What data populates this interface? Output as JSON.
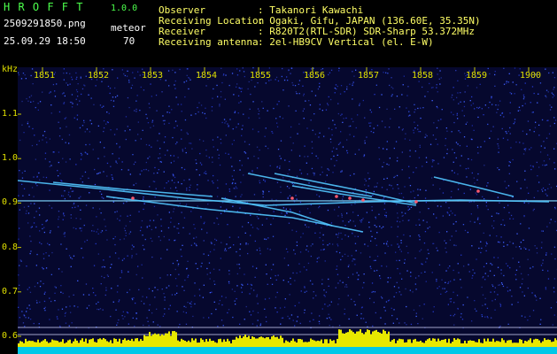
{
  "app": {
    "name": "H R O F F T",
    "version": "1.0.0",
    "file": "2509291850.png",
    "datetime": "25.09.29 18:50",
    "category_label": "meteor",
    "count": "70"
  },
  "info": {
    "rows": [
      {
        "key": "Observer",
        "value": ": Takanori Kawachi"
      },
      {
        "key": "Receiving Location",
        "value": ": Ogaki, Gifu, JAPAN (136.60E, 35.35N)"
      },
      {
        "key": "Receiver",
        "value": ": R820T2(RTL-SDR) SDR-Sharp 53.372MHz"
      },
      {
        "key": "Receiving antenna",
        "value": ": 2el-HB9CV Vertical (el. E-W)"
      }
    ]
  },
  "colors": {
    "accent_green": "#4cff4c",
    "info_yellow": "#ffff66",
    "axis_yellow": "#e0e000",
    "background": "#06082e"
  },
  "chart_data": {
    "type": "heatmap",
    "y_unit": "kHz",
    "y_ticks": [
      "1.1",
      "1.0",
      "0.9",
      "0.8",
      "0.7",
      "0.6"
    ],
    "x_ticks": [
      "1851",
      "1852",
      "1853",
      "1854",
      "1855",
      "1856",
      "1857",
      "1858",
      "1859",
      "1900"
    ],
    "ylim": [
      0.58,
      1.2
    ],
    "xlim": [
      "18:50",
      "19:00"
    ],
    "carrier_khz": 0.905
  }
}
